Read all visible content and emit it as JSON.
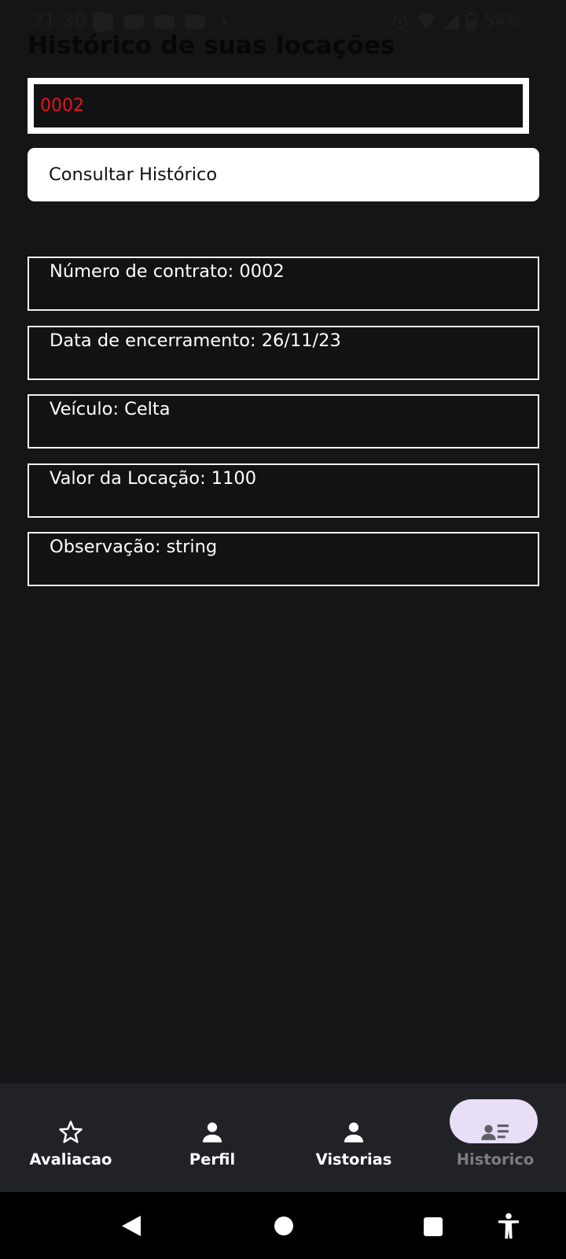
{
  "status_bar": {
    "time": "21:30",
    "notification_icons": [
      "app-icon",
      "youtube-icon",
      "youtube-icon",
      "youtube-icon",
      "dot-icon"
    ],
    "right_icons": [
      "alarm-icon",
      "wifi-icon",
      "signal-icon",
      "battery-icon"
    ],
    "battery": "54%"
  },
  "page": {
    "title": "Histórico de suas locações"
  },
  "search": {
    "value": "0002"
  },
  "consult_button": {
    "label": "Consultar Histórico"
  },
  "details": [
    {
      "label": "Número de contrato: 0002"
    },
    {
      "label": "Data de encerramento: 26/11/23"
    },
    {
      "label": "Veículo: Celta"
    },
    {
      "label": "Valor da Locação: 1100"
    },
    {
      "label": "Observação: string"
    }
  ],
  "bottom_nav": {
    "items": [
      {
        "label": "Avaliacao",
        "icon": "star-outline-icon",
        "active": false
      },
      {
        "label": "Perfil",
        "icon": "person-icon",
        "active": false
      },
      {
        "label": "Vistorias",
        "icon": "person-icon",
        "active": false
      },
      {
        "label": "Historico",
        "icon": "contact-list-icon",
        "active": true
      }
    ],
    "active_color": "#e8def8"
  },
  "system_nav": {
    "buttons": [
      "back-icon",
      "home-icon",
      "recents-icon",
      "accessibility-icon"
    ]
  },
  "colors": {
    "background": "#151517",
    "input_text": "#e8121c",
    "border": "#ffffff",
    "nav_background": "#212226"
  }
}
